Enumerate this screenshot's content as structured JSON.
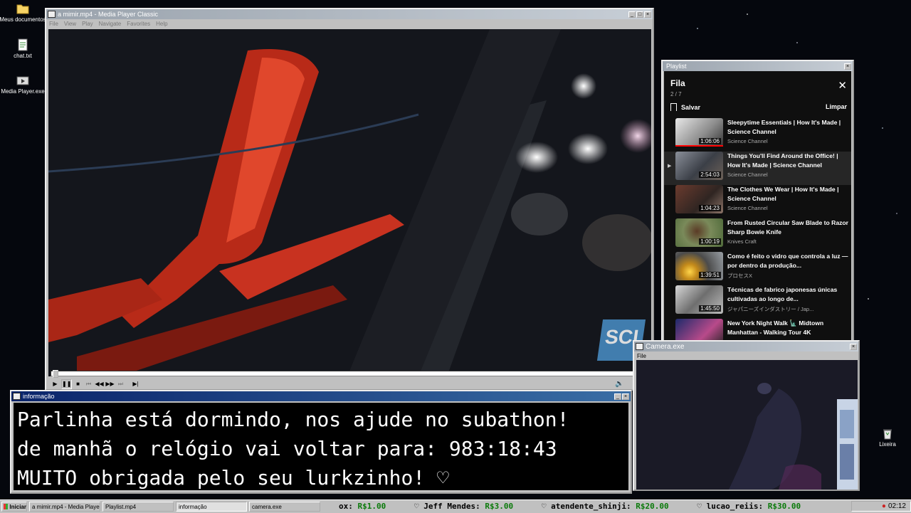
{
  "desktop": {
    "icons": [
      {
        "label": "Meus documentos"
      },
      {
        "label": "chat.txt"
      },
      {
        "label": "Media Player.exe"
      }
    ],
    "recycle_label": "Lixeira"
  },
  "player": {
    "title": "a mimir.mp4 - Media Player Classic",
    "menu": [
      "File",
      "View",
      "Play",
      "Navigate",
      "Favorites",
      "Help"
    ],
    "watermark": "SCI",
    "seek_fraction": 0.0
  },
  "playlist": {
    "window_title": "Playlist",
    "heading": "Fila",
    "count": "2 / 7",
    "save_label": "Salvar",
    "clear_label": "Limpar",
    "items": [
      {
        "title": "Sleepytime Essentials | How It's Made | Science Channel",
        "channel": "Science Channel",
        "duration": "1:06:06",
        "active": false
      },
      {
        "title": "Things You'll Find Around the Office! | How It's Made | Science Channel",
        "channel": "Science Channel",
        "duration": "2:54:03",
        "active": true
      },
      {
        "title": "The Clothes We Wear | How It's Made | Science Channel",
        "channel": "Science Channel",
        "duration": "1:04:23",
        "active": false
      },
      {
        "title": "From Rusted Circular Saw Blade to Razor Sharp Bowie Knife",
        "channel": "Knives Craft",
        "duration": "1:00:19",
        "active": false
      },
      {
        "title": "Como é feito o vidro que controla a luz — por dentro da produção...",
        "channel": "プロセスX",
        "duration": "1:39:51",
        "active": false
      },
      {
        "title": "Técnicas de fabrico japonesas únicas cultivadas ao longo de...",
        "channel": "ジャパニーズインダストリー / Jap...",
        "duration": "1:45:50",
        "active": false
      },
      {
        "title": "New York Night Walk 🗽 Midtown Manhattan - Walking Tour 4K",
        "channel": "",
        "duration": "",
        "active": false
      }
    ]
  },
  "camera": {
    "title": "Camera.exe",
    "menu": [
      "File"
    ]
  },
  "info": {
    "title": "informação",
    "lines": [
      "Parlinha está dormindo, nos ajude no subathon!",
      "de manhã o relógio vai voltar para:  983:18:43",
      "MUITO obrigada pelo seu lurkzinho! ♡"
    ]
  },
  "taskbar": {
    "start_label": "Iniciar",
    "tasks": [
      "a mimir.mp4 - Media Playe...",
      "Playlist.mp4",
      "informação",
      "camera.exe"
    ],
    "ticker": [
      {
        "name": "ox: ",
        "amount": "R$1.00"
      },
      {
        "name": "♡ Jeff Mendes: ",
        "amount": "R$3.00"
      },
      {
        "name": "♡ atendente_shinji: ",
        "amount": "R$20.00"
      },
      {
        "name": "♡ lucao_reiis: ",
        "amount": "R$30.00"
      }
    ],
    "clock": "02:12"
  },
  "colors": {
    "title_active": "#0a246a",
    "window_face": "#c0c0c0",
    "playlist_bg": "#0f0f0f",
    "ticker_amount": "#0a7a0a",
    "video_accent": "#d43a24"
  }
}
